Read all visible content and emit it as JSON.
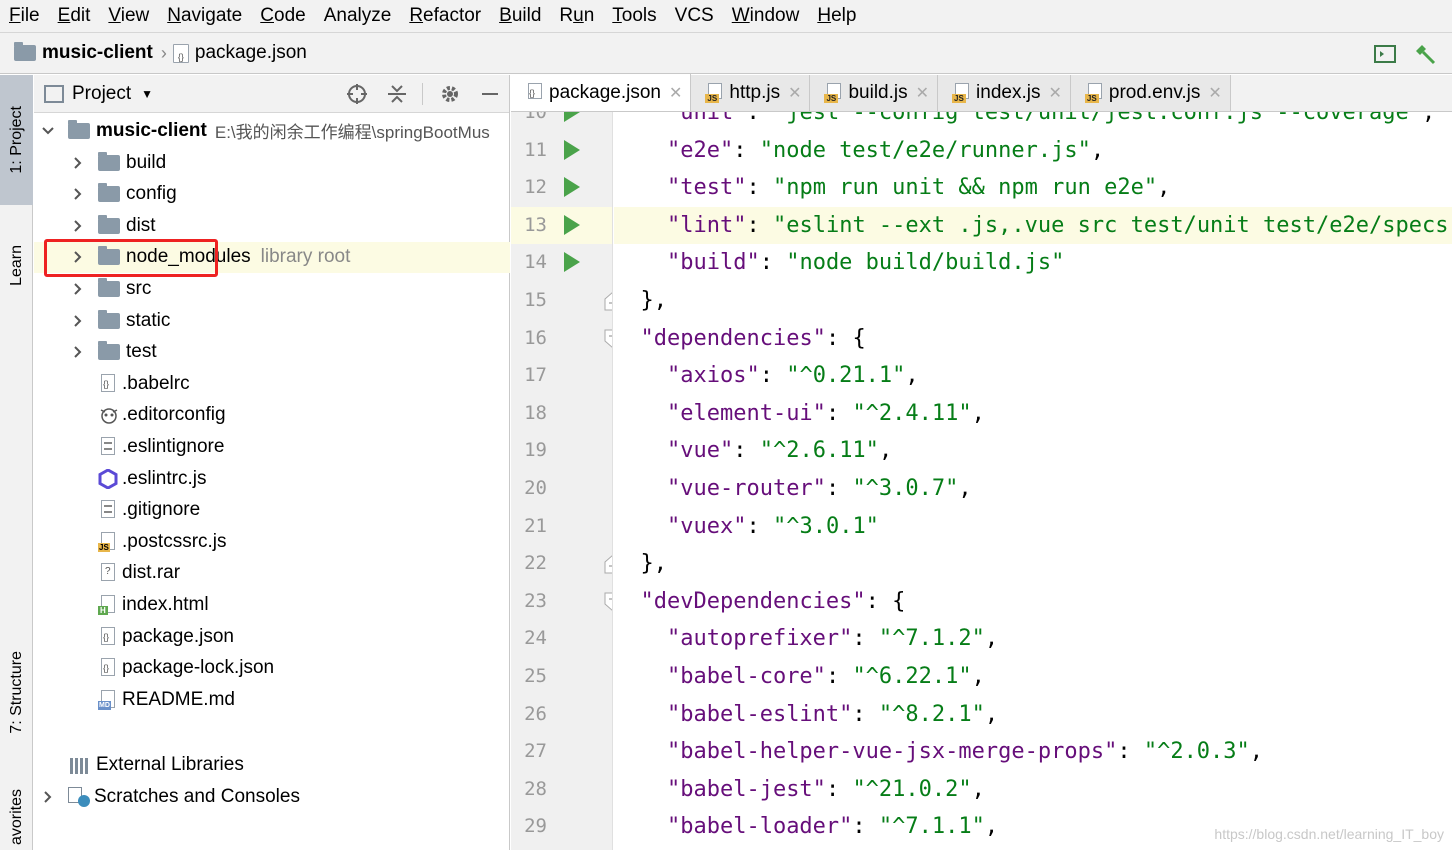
{
  "menu": [
    "File",
    "Edit",
    "View",
    "Navigate",
    "Code",
    "Analyze",
    "Refactor",
    "Build",
    "Run",
    "Tools",
    "VCS",
    "Window",
    "Help"
  ],
  "menu_mnemonics": [
    "F",
    "E",
    "V",
    "N",
    "C",
    "",
    "R",
    "B",
    "u",
    "T",
    "",
    "W",
    "H"
  ],
  "breadcrumb": {
    "project": "music-client",
    "file": "package.json"
  },
  "toolstrip": {
    "project": "1: Project",
    "learn": "Learn",
    "structure": "7: Structure",
    "favorites": "avorites"
  },
  "project_panel": {
    "title": "Project",
    "root": {
      "name": "music-client",
      "path": "E:\\我的闲余工作编程\\springBootMus"
    },
    "items": [
      {
        "label": "build",
        "type": "folder"
      },
      {
        "label": "config",
        "type": "folder"
      },
      {
        "label": "dist",
        "type": "folder"
      },
      {
        "label": "node_modules",
        "type": "folder",
        "note": "library root"
      },
      {
        "label": "src",
        "type": "folder"
      },
      {
        "label": "static",
        "type": "folder"
      },
      {
        "label": "test",
        "type": "folder"
      },
      {
        "label": ".babelrc",
        "type": "json"
      },
      {
        "label": ".editorconfig",
        "type": "config"
      },
      {
        "label": ".eslintignore",
        "type": "text"
      },
      {
        "label": ".eslintrc.js",
        "type": "eslint"
      },
      {
        "label": ".gitignore",
        "type": "text"
      },
      {
        "label": ".postcssrc.js",
        "type": "js"
      },
      {
        "label": "dist.rar",
        "type": "unknown"
      },
      {
        "label": "index.html",
        "type": "html"
      },
      {
        "label": "package.json",
        "type": "json"
      },
      {
        "label": "package-lock.json",
        "type": "json"
      },
      {
        "label": "README.md",
        "type": "md"
      }
    ],
    "external": "External Libraries",
    "scratches": "Scratches and Consoles"
  },
  "tabs": [
    {
      "label": "package.json",
      "active": true,
      "icon": "json"
    },
    {
      "label": "http.js",
      "icon": "js"
    },
    {
      "label": "build.js",
      "icon": "js"
    },
    {
      "label": "index.js",
      "icon": "js"
    },
    {
      "label": "prod.env.js",
      "icon": "js"
    }
  ],
  "code": {
    "current_line": 13,
    "lines": [
      {
        "n": "10",
        "key": "unit",
        "val": "jest --config test/unit/jest.conf.js --coverage",
        "run": true,
        "partial": true
      },
      {
        "n": "11",
        "key": "e2e",
        "val": "node test/e2e/runner.js",
        "run": true,
        "indent": 2
      },
      {
        "n": "12",
        "key": "test",
        "val": "npm run unit && npm run e2e",
        "run": true,
        "indent": 2
      },
      {
        "n": "13",
        "key": "lint",
        "val": "eslint --ext .js,.vue src test/unit test/e2e/specs",
        "run": true,
        "indent": 2
      },
      {
        "n": "14",
        "key": "build",
        "val": "node build/build.js",
        "run": true,
        "indent": 2,
        "last": true
      },
      {
        "n": "15",
        "raw": "},",
        "fold": "end",
        "indent": 1
      },
      {
        "n": "16",
        "key": "dependencies",
        "open": "{",
        "fold": "start",
        "indent": 1
      },
      {
        "n": "17",
        "key": "axios",
        "val": "^0.21.1",
        "indent": 2
      },
      {
        "n": "18",
        "key": "element-ui",
        "val": "^2.4.11",
        "indent": 2
      },
      {
        "n": "19",
        "key": "vue",
        "val": "^2.6.11",
        "indent": 2
      },
      {
        "n": "20",
        "key": "vue-router",
        "val": "^3.0.7",
        "indent": 2
      },
      {
        "n": "21",
        "key": "vuex",
        "val": "^3.0.1",
        "indent": 2,
        "last": true
      },
      {
        "n": "22",
        "raw": "},",
        "fold": "end",
        "indent": 1
      },
      {
        "n": "23",
        "key": "devDependencies",
        "open": "{",
        "fold": "start",
        "indent": 1
      },
      {
        "n": "24",
        "key": "autoprefixer",
        "val": "^7.1.2",
        "indent": 2
      },
      {
        "n": "25",
        "key": "babel-core",
        "val": "^6.22.1",
        "indent": 2
      },
      {
        "n": "26",
        "key": "babel-eslint",
        "val": "^8.2.1",
        "indent": 2
      },
      {
        "n": "27",
        "key": "babel-helper-vue-jsx-merge-props",
        "val": "^2.0.3",
        "indent": 2
      },
      {
        "n": "28",
        "key": "babel-jest",
        "val": "^21.0.2",
        "indent": 2
      },
      {
        "n": "29",
        "key": "babel-loader",
        "val": "^7.1.1",
        "indent": 2
      }
    ]
  },
  "watermark": "https://blog.csdn.net/learning_IT_boy",
  "colors": {
    "key": "#660e7a",
    "string": "#067d17",
    "highlight": "#fcfbe3",
    "run": "#4aa34a",
    "redbox": "#e22222"
  }
}
